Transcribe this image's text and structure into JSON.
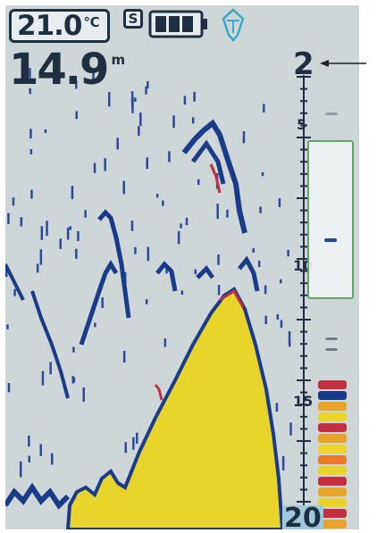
{
  "status_bar": {
    "temperature_value": "21.0",
    "temperature_unit": "℃",
    "sonar_mode_badge": "S",
    "battery_icon": "battery-icon",
    "battery_bars": 3,
    "fish_alarm_icon": "fish-alarm-icon"
  },
  "depth_reading": {
    "value": "14.9",
    "unit": "m"
  },
  "depth_scale": {
    "range_top": "2",
    "range_bottom": "20",
    "labels": [
      "5",
      "10",
      "15"
    ]
  },
  "zoom_window": {
    "label": "zoom-window"
  },
  "colors": {
    "background_water": "#cfd6d7",
    "echo_strong": "#1a3a8a",
    "echo_peak": "#c03040",
    "bottom_fill": "#e8d42a",
    "text_dark": "#1f2f42",
    "fish_icon": "#3aa8c8",
    "zoom_border": "#5da86a"
  },
  "callout": {
    "arrow_icon": "arrow-left-icon"
  }
}
